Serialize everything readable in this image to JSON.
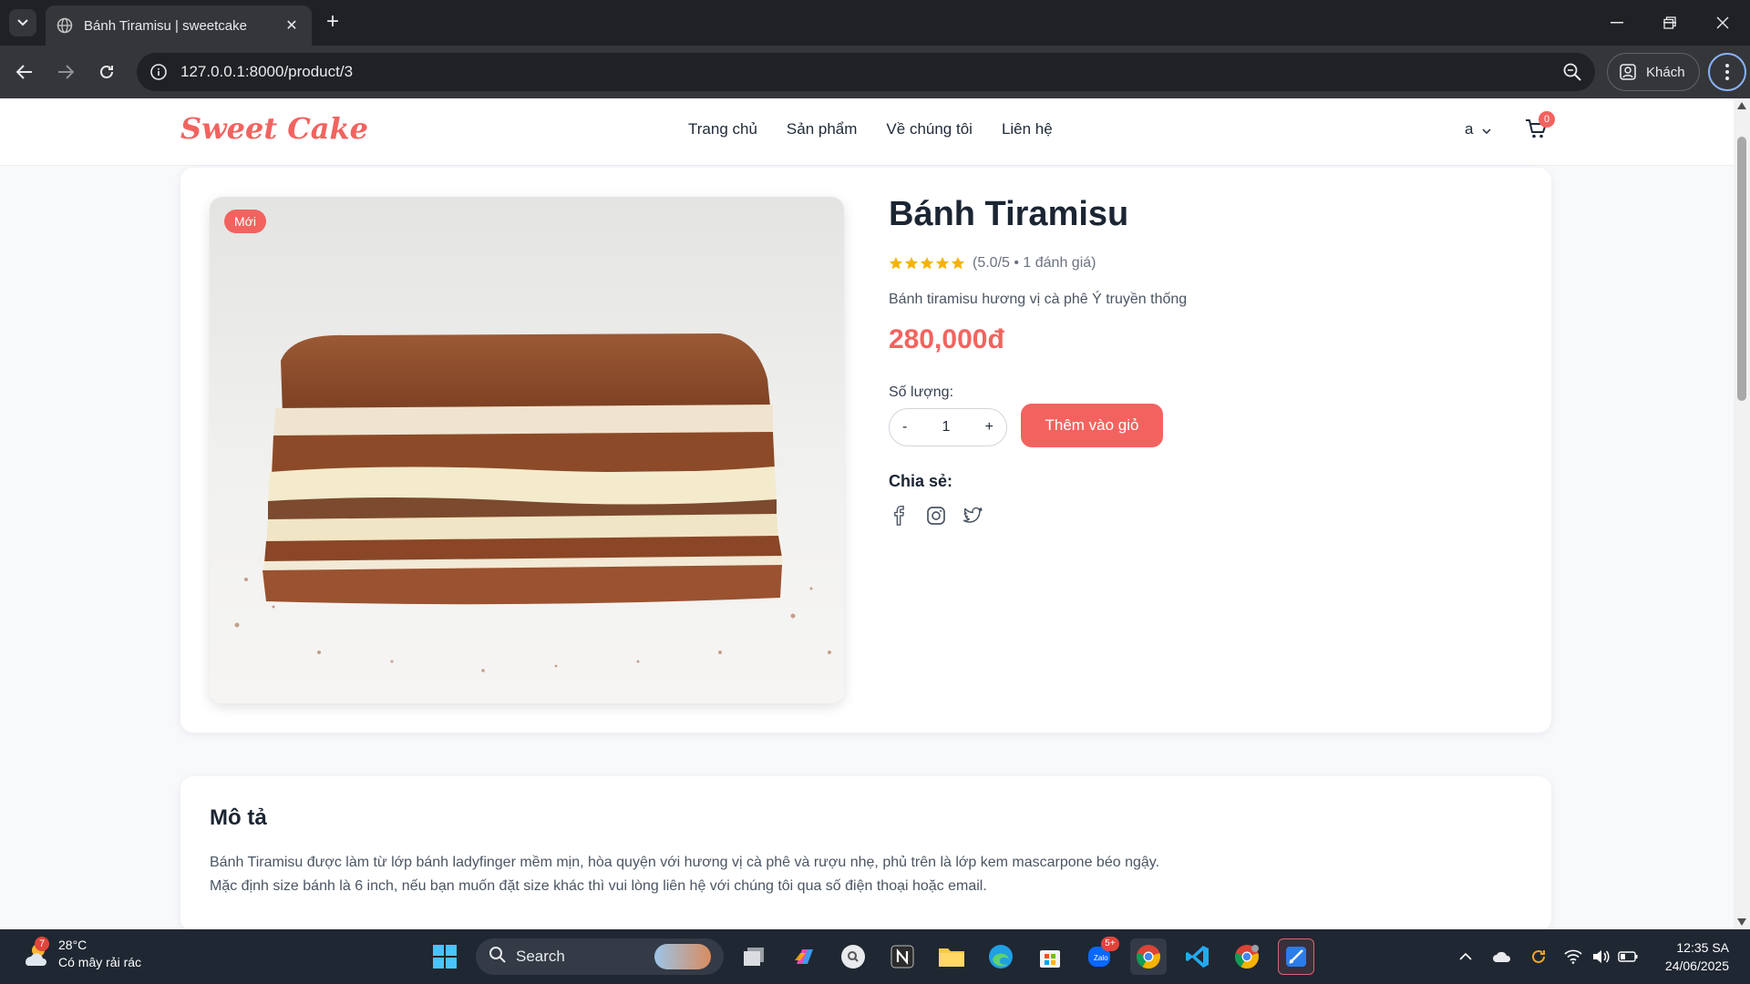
{
  "browser": {
    "tab_title": "Bánh Tiramisu | sweetcake",
    "url": "127.0.0.1:8000/product/3",
    "profile_label": "Khách"
  },
  "site": {
    "logo": "Sweet Cake",
    "nav": [
      "Trang chủ",
      "Sản phẩm",
      "Về chúng tôi",
      "Liên hệ"
    ],
    "user": "a",
    "cart_count": "0",
    "brand_color": "#f2635f"
  },
  "product": {
    "badge": "Mới",
    "name": "Bánh Tiramisu",
    "rating_value": 5.0,
    "rating_text": "(5.0/5 • 1 đánh giá)",
    "short_description": "Bánh tiramisu hương vị cà phê Ý truyền thống",
    "price": "280,000đ",
    "quantity_label": "Số lượng:",
    "quantity_minus": "-",
    "quantity": "1",
    "quantity_plus": "+",
    "add_to_cart": "Thêm vào giỏ",
    "share_label": "Chia sẻ:",
    "share_icons": [
      "facebook-icon",
      "instagram-icon",
      "twitter-icon"
    ]
  },
  "description": {
    "title": "Mô tả",
    "lines": [
      "Bánh Tiramisu được làm từ lớp bánh ladyfinger mềm mịn, hòa quyện với hương vị cà phê và rượu nhẹ, phủ trên là lớp kem mascarpone béo ngậy.",
      "Mặc định size bánh là 6 inch, nếu bạn muốn đặt size khác thì vui lòng liên hệ với chúng tôi qua số điện thoại hoặc email."
    ]
  },
  "taskbar": {
    "weather_badge": "7",
    "temperature": "28°C",
    "weather_text": "Có mây rải rác",
    "search_label": "Search",
    "time": "12:35 SA",
    "date": "24/06/2025",
    "zalo_badge": "5+"
  }
}
